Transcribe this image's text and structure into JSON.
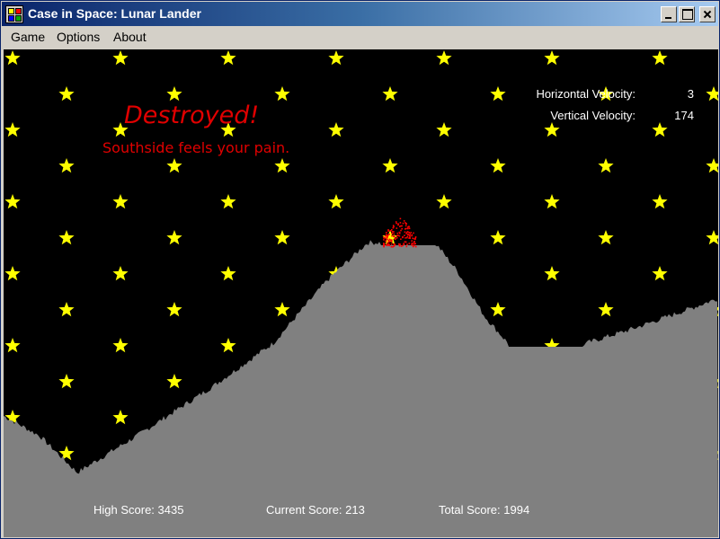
{
  "window": {
    "title": "Case in Space: Lunar Lander"
  },
  "menu": {
    "items": [
      "Game",
      "Options",
      "About"
    ]
  },
  "hud": {
    "horizontal_velocity_label": "Horizontal Velocity:",
    "horizontal_velocity_value": "3",
    "vertical_velocity_label": "Vertical Velocity:",
    "vertical_velocity_value": "174"
  },
  "message": {
    "title": "Destroyed!",
    "subtitle": "Southside feels your pain."
  },
  "scores": {
    "high": "High Score: 3435",
    "current": "Current Score: 213",
    "total": "Total Score: 1994"
  },
  "colors": {
    "sky": "#000000",
    "star": "#ffff00",
    "terrain": "#808080",
    "message": "#e00000",
    "debris": "#ff0000"
  }
}
